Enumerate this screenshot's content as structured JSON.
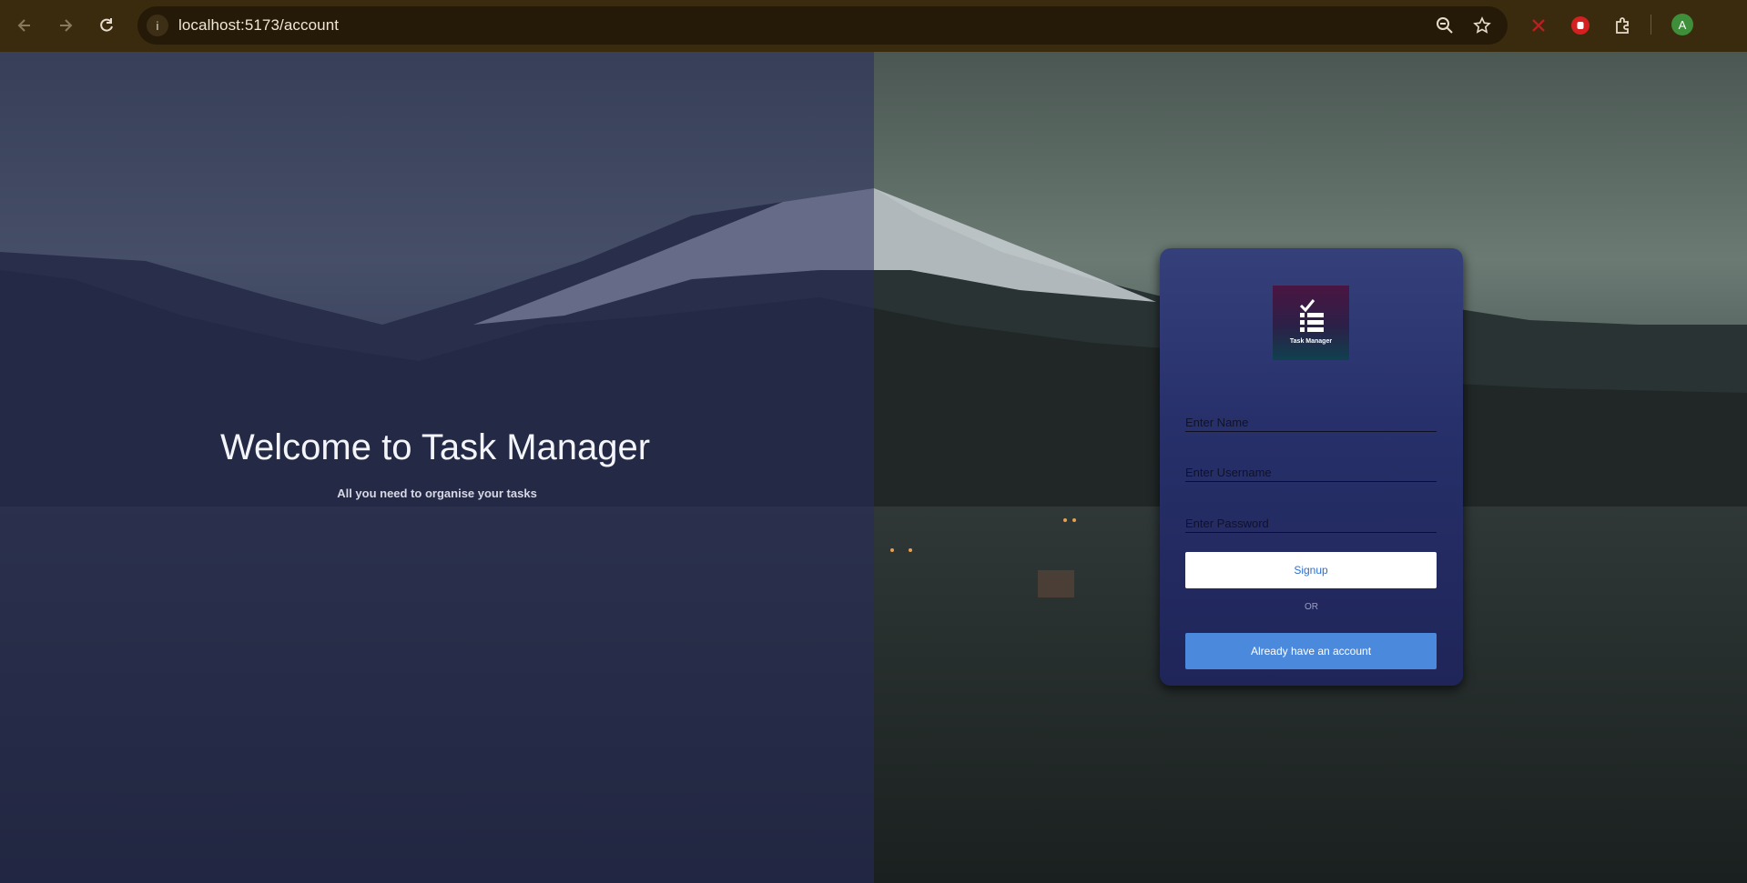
{
  "browser": {
    "url": "localhost:5173/account",
    "avatar_initial": "A"
  },
  "hero": {
    "title": "Welcome to Task Manager",
    "subtitle": "All you need to organise your tasks"
  },
  "card": {
    "logo_text": "Task Manager",
    "name_placeholder": "Enter Name",
    "username_placeholder": "Enter Username",
    "password_placeholder": "Enter Password",
    "signup_label": "Signup",
    "or_label": "OR",
    "login_label": "Already have an account"
  },
  "colors": {
    "chrome": "#3a2a0e",
    "left_overlay": "#282c5f",
    "card": "#27306a",
    "signup_text": "#2c6fd1",
    "login_button": "#4b89dc"
  },
  "icons": {
    "back": "arrow-left-icon",
    "forward": "arrow-right-icon",
    "reload": "reload-icon",
    "site_info": "info-icon",
    "zoom": "zoom-out-icon",
    "bookmark": "star-icon",
    "ext1": "x-ext-icon",
    "ext2": "hand-stop-icon",
    "extensions": "puzzle-icon"
  }
}
